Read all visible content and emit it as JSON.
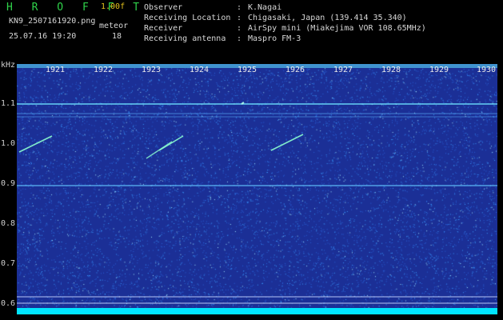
{
  "header": {
    "title": "H R O F F T",
    "version": "1.00f",
    "filename": "KN9_2507161920.png",
    "mode": "meteor",
    "datetime": "25.07.16 19:20",
    "count": "18"
  },
  "meta": [
    {
      "key": "Observer",
      "value": "K.Nagai"
    },
    {
      "key": "Receiving Location",
      "value": "Chigasaki, Japan (139.414 35.340)"
    },
    {
      "key": "Receiver",
      "value": "AirSpy mini (Miakejima VOR 108.65MHz)"
    },
    {
      "key": "Receiving antenna",
      "value": "Maspro FM-3"
    }
  ],
  "sep": ":",
  "axis": {
    "unit": "kHz",
    "y_ticks": [
      "1.1",
      "1.0",
      "0.9",
      "0.8",
      "0.7",
      "0.6"
    ],
    "minutes": [
      "1921",
      "1922",
      "1923",
      "1924",
      "1925",
      "1926",
      "1927",
      "1928",
      "1929",
      "1930"
    ]
  },
  "colors": {
    "background": "#1b2f96",
    "noise": "#3a9bff",
    "signal": "#8cffd0",
    "baseline": "#00e5ff",
    "title": "#2fd24a",
    "version": "#e4c21c"
  }
}
